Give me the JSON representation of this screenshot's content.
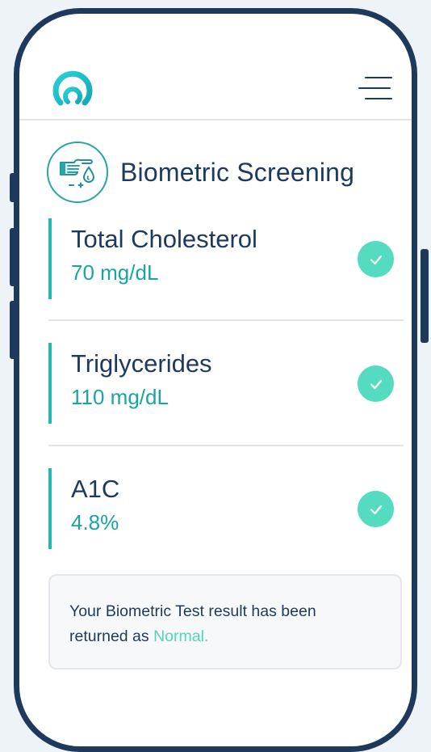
{
  "app": {
    "logo_icon": "app-logo-icon",
    "menu_icon": "hamburger-menu-icon"
  },
  "screening": {
    "title": "Biometric Screening",
    "icon": "finger-blood-drop-icon"
  },
  "results": [
    {
      "name": "Total Cholesterol",
      "value": "70 mg/dL",
      "status_icon": "check-circle-icon"
    },
    {
      "name": "Triglycerides",
      "value": "110 mg/dL",
      "status_icon": "check-circle-icon"
    },
    {
      "name": "A1C",
      "value": "4.8%",
      "status_icon": "check-circle-icon"
    }
  ],
  "summary": {
    "line1": "Your Biometric Test result has been",
    "line2_prefix": "returned as ",
    "status": "Normal."
  },
  "colors": {
    "navy": "#1d3a5d",
    "teal": "#26b8b0",
    "mint": "#55dcc0",
    "background": "#eef3f8"
  }
}
